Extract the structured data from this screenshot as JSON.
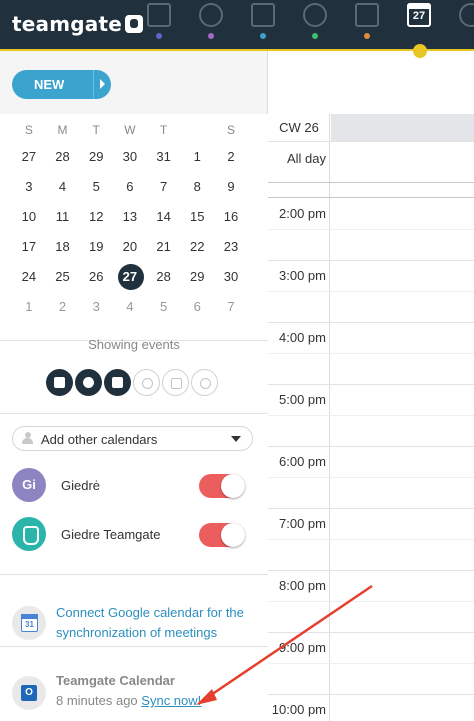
{
  "app": {
    "logo": "teamgate"
  },
  "nav": {
    "items": [
      {
        "name": "dashboard",
        "dot": "#6264c8"
      },
      {
        "name": "targets",
        "dot": "#a46ac9"
      },
      {
        "name": "companies",
        "dot": "#3f9fcf"
      },
      {
        "name": "people",
        "dot": "#3cbf73"
      },
      {
        "name": "deals",
        "dot": "#e48b3d"
      }
    ],
    "calendar_day": "27"
  },
  "new_button": {
    "label": "NEW"
  },
  "mini_calendar": {
    "weekdays": [
      "S",
      "M",
      "T",
      "W",
      "T",
      "S"
    ],
    "weeks": [
      [
        "27",
        "28",
        "29",
        "30",
        "31",
        "1",
        "2"
      ],
      [
        "3",
        "4",
        "5",
        "6",
        "7",
        "8",
        "9"
      ],
      [
        "10",
        "11",
        "12",
        "13",
        "14",
        "15",
        "16"
      ],
      [
        "17",
        "18",
        "19",
        "20",
        "21",
        "22",
        "23"
      ],
      [
        "24",
        "25",
        "26",
        "27",
        "28",
        "29",
        "30"
      ],
      [
        "1",
        "2",
        "3",
        "4",
        "5",
        "6",
        "7"
      ]
    ],
    "today": "27"
  },
  "events_filter": {
    "label": "Showing events"
  },
  "add_calendars": {
    "label": "Add other calendars"
  },
  "calendars": [
    {
      "initials": "Gi",
      "name": "Giedrė",
      "enabled": true
    },
    {
      "initials": "",
      "name": "Giedre Teamgate",
      "enabled": true
    }
  ],
  "google": {
    "icon_day": "31",
    "text": "Connect Google calendar for the synchronization of meetings"
  },
  "teamgate_calendar": {
    "name": "Teamgate Calendar",
    "synced": "8 minutes ago",
    "sync_link": "Sync now!"
  },
  "week_view": {
    "cw": "CW 26",
    "all_day": "All day",
    "hours": [
      "2:00 pm",
      "3:00 pm",
      "4:00 pm",
      "5:00 pm",
      "6:00 pm",
      "7:00 pm",
      "8:00 pm",
      "9:00 pm",
      "10:00 pm"
    ]
  },
  "colors": {
    "accent": "#3aa4cf",
    "toggle_on": "#ec5d5e",
    "nav_bg": "#21303d",
    "active_indicator": "#e8c623",
    "arrow": "#e5402f"
  }
}
